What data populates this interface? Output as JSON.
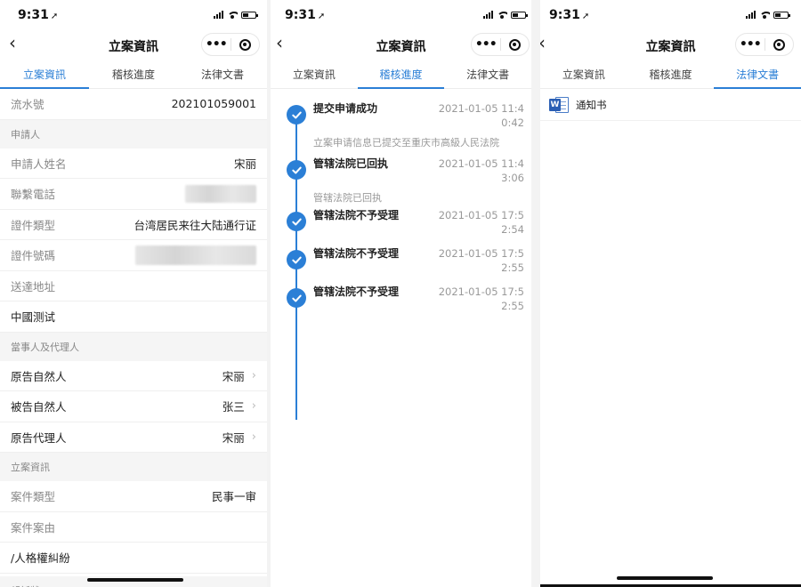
{
  "status": {
    "time": "9:31"
  },
  "nav": {
    "title": "立案資訊",
    "more": "•••"
  },
  "tabs": [
    "立案資訊",
    "稽核進度",
    "法律文書"
  ],
  "panel1": {
    "serial_label": "流水號",
    "serial_value": "202101059001",
    "applicant_section": "申請人",
    "applicant_name_label": "申請人姓名",
    "applicant_name_value": "宋丽",
    "phone_label": "聯繫電話",
    "id_type_label": "證件類型",
    "id_type_value": "台湾居民来往大陆通行证",
    "id_number_label": "證件號碼",
    "address_label": "送達地址",
    "address_value": "中國测试",
    "parties_section": "當事人及代理人",
    "plaintiff_label": "原告自然人",
    "plaintiff_value": "宋丽",
    "defendant_label": "被告自然人",
    "defendant_value": "张三",
    "agent_label": "原告代理人",
    "agent_value": "宋丽",
    "case_section": "立案資訊",
    "case_type_label": "案件類型",
    "case_type_value": "民事一审",
    "case_cause_label": "案件案由",
    "case_cause_value": "/人格權糾紛",
    "complaint_section": "起訴狀"
  },
  "timeline": [
    {
      "title": "提交申请成功",
      "time": "2021-01-05 11:40:42",
      "desc": "立案申请信息已提交至重庆市高級人民法院"
    },
    {
      "title": "管辖法院已回执",
      "time": "2021-01-05 11:43:06",
      "desc": "管辖法院已回执"
    },
    {
      "title": "管辖法院不予受理",
      "time": "2021-01-05 17:52:54",
      "desc": ""
    },
    {
      "title": "管辖法院不予受理",
      "time": "2021-01-05 17:52:55",
      "desc": ""
    },
    {
      "title": "管辖法院不予受理",
      "time": "2021-01-05 17:52:55",
      "desc": ""
    }
  ],
  "documents": [
    {
      "icon": "word-doc-icon",
      "icon_letter": "W",
      "name": "通知书"
    }
  ],
  "colors": {
    "accent": "#2b7fd6",
    "section_bg": "#f5f5f5"
  }
}
